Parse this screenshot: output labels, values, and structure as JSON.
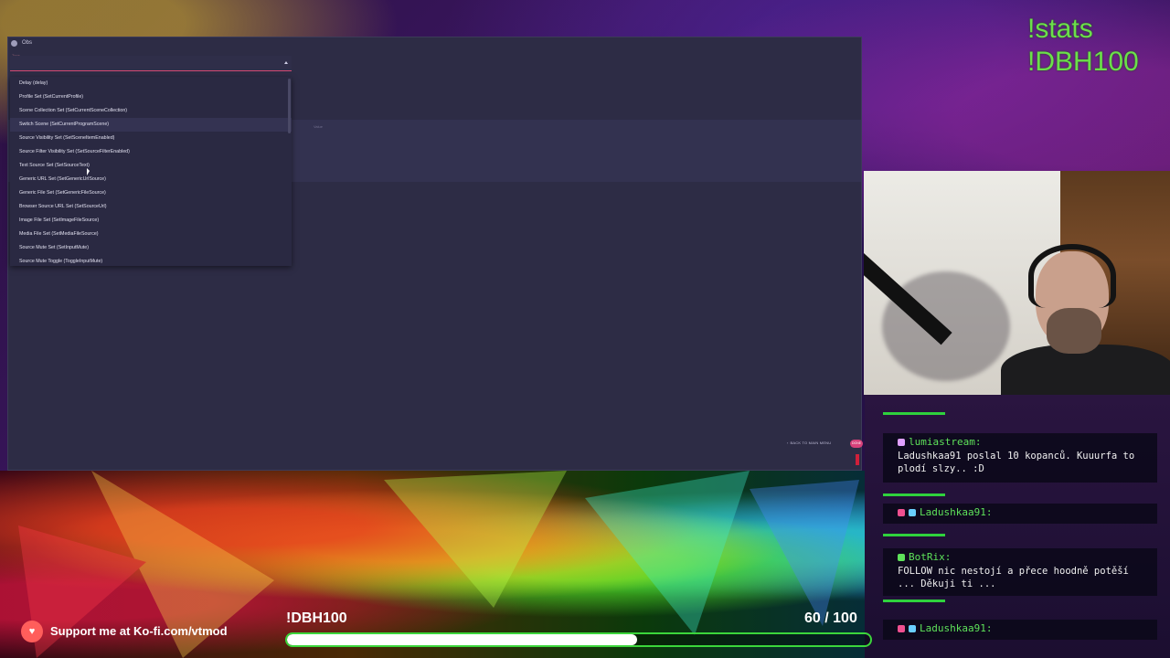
{
  "obs": {
    "title": "Obs",
    "type_label": "Type",
    "value_label": "Value",
    "dropdown_items": [
      "Delay (delay)",
      "Profile Set (SetCurrentProfile)",
      "Scene Collection Set (SetCurrentSceneCollection)",
      "Switch Scene (SetCurrentProgramScene)",
      "Source Visibility Set (SetSceneItemEnabled)",
      "Source Filter Visibility Set (SetSourceFilterEnabled)",
      "Text Source Set (SetSourceText)",
      "Generic URL Set (SetGenericUrlSource)",
      "Generic File Set (SetGenericFileSource)",
      "Browser Source URL Set (SetSourceUrl)",
      "Image File Set (SetImageFileSource)",
      "Media File Set (SetMediaFileSource)",
      "Source Mute Set (SetInputMute)",
      "Source Mute Toggle (ToggleInputMute)"
    ],
    "back_button": "BACK TO MAIN MENU",
    "done_button": "DONE"
  },
  "commands": [
    "!stats",
    "!DBH100"
  ],
  "chat": [
    {
      "user": "lumiastream:",
      "text": "Ladushkaa91 poslal 10 kopanců. Kuuurfa to plodí slzy.. :D"
    },
    {
      "user": "Ladushkaa91:",
      "text": ""
    },
    {
      "user": "BotRix:",
      "text": "FOLLOW nic nestojí a přece hoodně potěší ... Děkuji ti ..."
    },
    {
      "user": "Ladushkaa91:",
      "text": ""
    }
  ],
  "kofi": {
    "text": "Support me at Ko-fi.com/vtmod",
    "icon": "heart-cup-icon"
  },
  "goal": {
    "label": "!DBH100",
    "current": "60",
    "separator": "/",
    "target": "100",
    "progress": 0.6
  },
  "colors": {
    "accent": "#d64a74",
    "green": "#2fd23d",
    "command": "#6be04a"
  }
}
